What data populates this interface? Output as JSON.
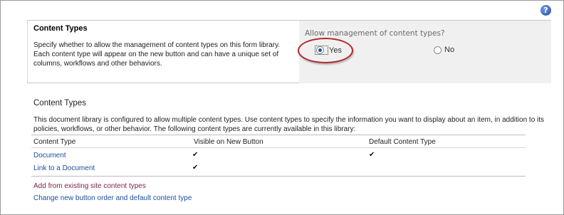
{
  "help": {
    "icon": "help-icon",
    "glyph": "?"
  },
  "settings": {
    "title": "Content Types",
    "description": "Specify whether to allow the management of content types on this form library. Each content type will appear on the new button and can have a unique set of columns, workflows and other behaviors.",
    "question": "Allow management of content types?",
    "options": [
      {
        "label": "Yes",
        "selected": true
      },
      {
        "label": "No",
        "selected": false
      }
    ],
    "highlight_color": "#b3262b"
  },
  "content_types": {
    "title": "Content Types",
    "description": "This document library is configured to allow multiple content types. Use content types to specify the information you want to display about an item, in addition to its policies, workflows, or other behavior. The following content types are currently available in this library:",
    "columns": [
      "Content Type",
      "Visible on New Button",
      "Default Content Type"
    ],
    "rows": [
      {
        "name": "Document",
        "visible": "✔",
        "default": "✔"
      },
      {
        "name": "Link to a Document",
        "visible": "✔",
        "default": ""
      }
    ],
    "actions": [
      {
        "label": "Add from existing site content types",
        "color": "#7a1f4a"
      },
      {
        "label": "Change new button order and default content type",
        "color": "#1b4f9c"
      }
    ]
  }
}
